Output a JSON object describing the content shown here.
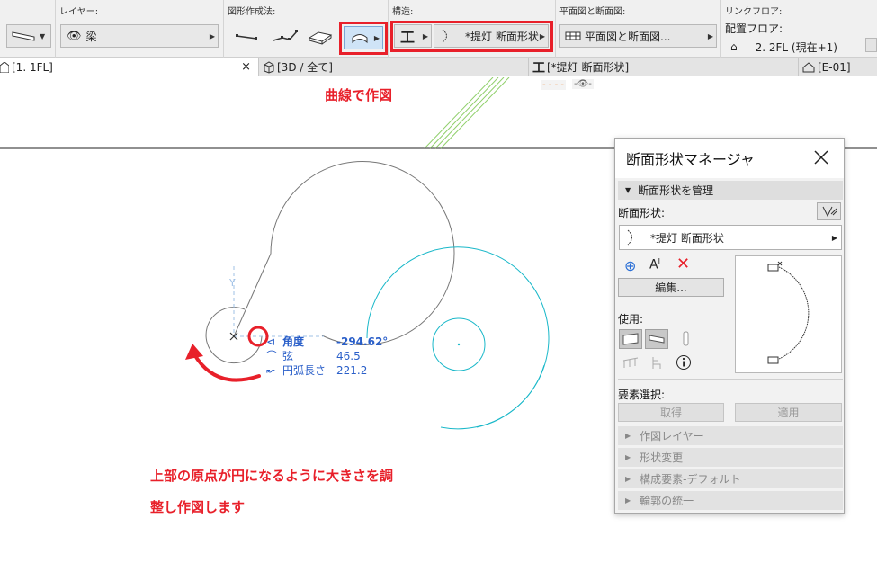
{
  "toolbar": {
    "layer_label": "レイヤー:",
    "layer_value": "梁",
    "geometry_label": "図形作成法:",
    "structure_label": "構造:",
    "structure_value": "*提灯 断面形状",
    "floorplan_label": "平面図と断面図:",
    "floorplan_value": "平面図と断面図...",
    "linkfloor_label": "リンクフロア:",
    "placement_label": "配置フロア:",
    "placement_value": "2. 2FL (現在+1)"
  },
  "tabs": [
    {
      "label": "[1. 1FL]",
      "close": "×"
    },
    {
      "label": "[3D / 全て]"
    },
    {
      "label": "[*提灯 断面形状]"
    },
    {
      "label": "[E-01]"
    }
  ],
  "canvas": {
    "mini_dashes": "- - - -",
    "mini_eye": "-👁-",
    "annotation_top": "曲線で作図",
    "annotation_line1": "上部の原点が円になるように大きさを調",
    "annotation_line2": "整し作図します",
    "axis_label": "Y",
    "readout": [
      {
        "label": "角度",
        "value": "-294.62°"
      },
      {
        "label": "弦",
        "value": "46.5"
      },
      {
        "label": "円弧長さ",
        "value": "221.2"
      }
    ]
  },
  "dialog": {
    "title": "断面形状マネージャ",
    "section_manage": "断面形状を管理",
    "profile_label": "断面形状:",
    "profile_value": "*提灯 断面形状",
    "edit_button": "編集...",
    "use_label": "使用:",
    "element_select_label": "要素選択:",
    "get_button": "取得",
    "apply_button": "適用",
    "sections": [
      "作図レイヤー",
      "形状変更",
      "構成要素-デフォルト",
      "輪郭の統一"
    ]
  },
  "colors": {
    "accent_red": "#e8202a",
    "readout_blue": "#2a5fc9",
    "cyan_circle": "#1ab8c9",
    "guide_green": "#8fcf6a"
  }
}
